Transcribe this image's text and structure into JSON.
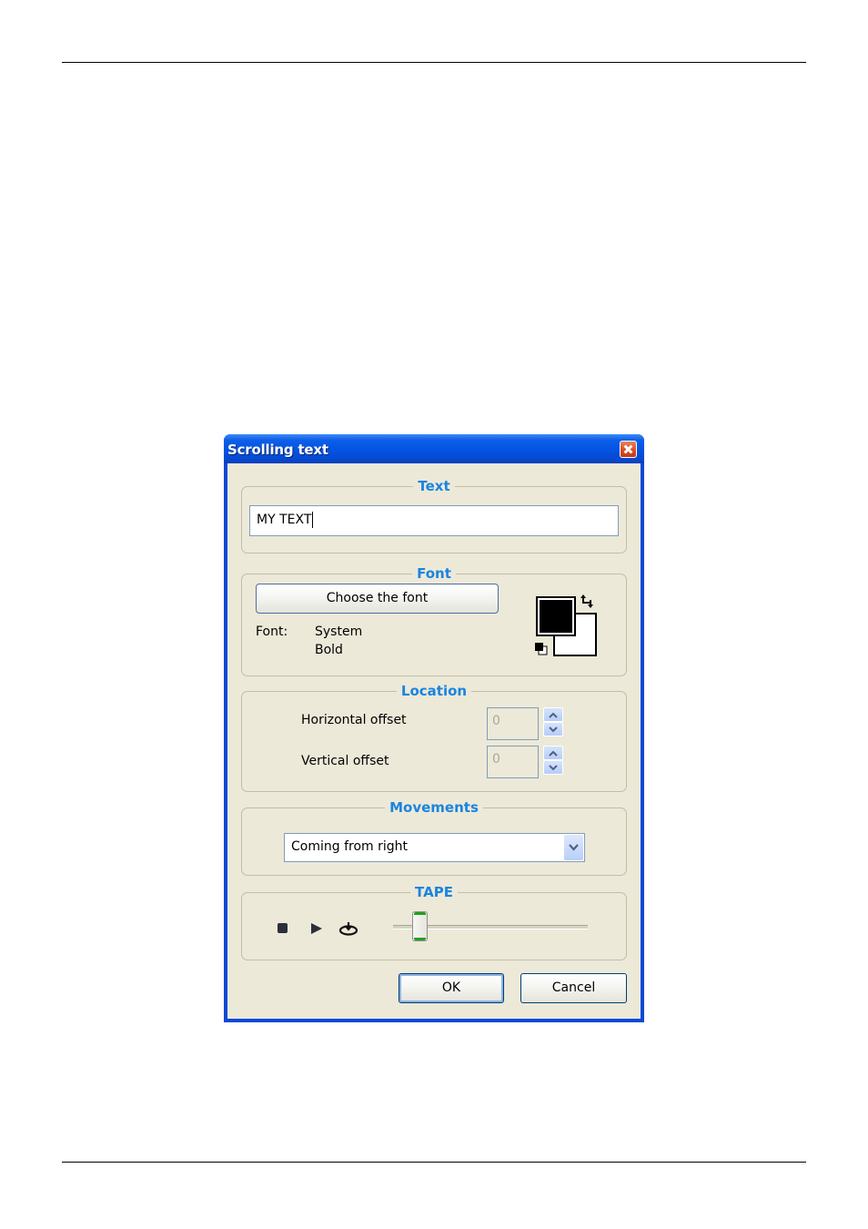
{
  "window": {
    "title": "Scrolling text",
    "close_label": "Close"
  },
  "text_group": {
    "legend": "Text",
    "value": "MY TEXT"
  },
  "font_group": {
    "legend": "Font",
    "choose_button": "Choose the font",
    "font_label": "Font:",
    "font_name": "System",
    "font_style": "Bold",
    "foreground_color": "#000000",
    "background_color": "#ffffff"
  },
  "location_group": {
    "legend": "Location",
    "horizontal_label": "Horizontal offset",
    "horizontal_value": "0",
    "vertical_label": "Vertical offset",
    "vertical_value": "0"
  },
  "movements_group": {
    "legend": "Movements",
    "selected": "Coming from right"
  },
  "tape_group": {
    "legend": "TAPE",
    "stop_icon": "stop-icon",
    "play_icon": "play-icon",
    "loop_icon": "loop-icon",
    "slider_position_fraction": 0.1
  },
  "buttons": {
    "ok": "OK",
    "cancel": "Cancel"
  },
  "colors": {
    "legend_blue": "#1a84e0",
    "titlebar_blue": "#0355e5",
    "dialog_bg": "#ece9d8"
  }
}
